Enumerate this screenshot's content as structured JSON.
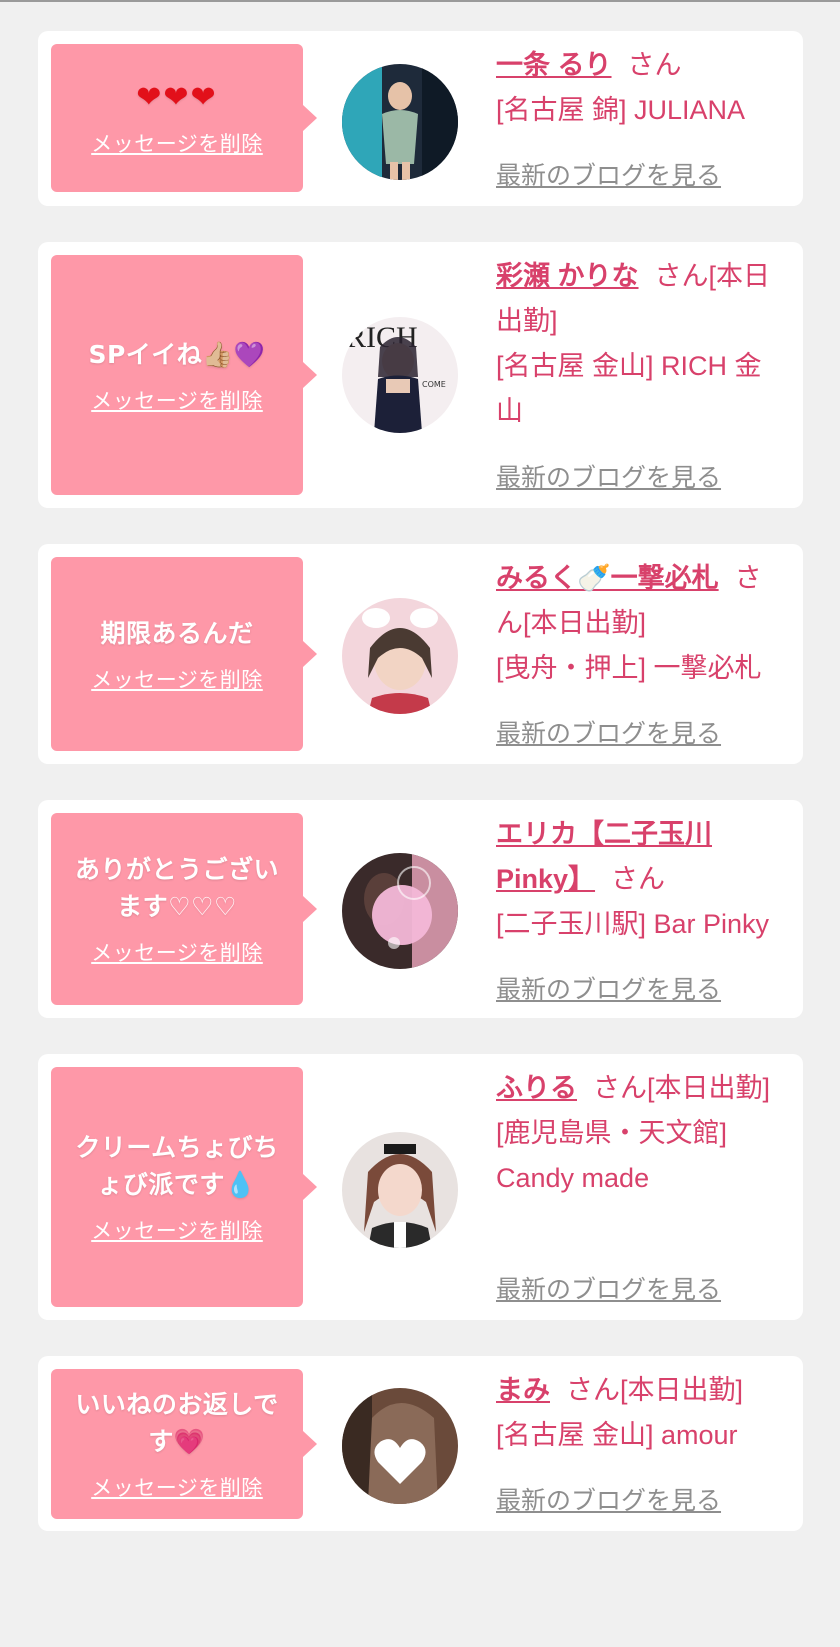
{
  "delete_label": "メッセージを削除",
  "blog_label": "最新のブログを見る",
  "honorific": "さん",
  "colors": {
    "bubble": "#fe98a8",
    "accent": "#d8416b",
    "link_gray": "#8e8e8e",
    "background": "#f0f0f0"
  },
  "cards": [
    {
      "message": "❤❤❤",
      "name": "一条 るり",
      "suffix": "さん",
      "shop": "[名古屋 錦] JULIANA"
    },
    {
      "message": "SPイイね👍🏼💜",
      "name": "彩瀬 かりな",
      "suffix": "さん[本日出勤]",
      "shop": "[名古屋 金山] RICH 金山"
    },
    {
      "message": "期限あるんだ",
      "name": "みるく🍼一撃必札",
      "suffix": "さん[本日出勤]",
      "shop": "[曳舟・押上] 一撃必札"
    },
    {
      "message": "ありがとうございます♡♡♡",
      "name": "エリカ【二子玉川Pinky】",
      "suffix": "さん",
      "shop": "[二子玉川駅] Bar Pinky"
    },
    {
      "message": "クリームちょびちょび派です💧",
      "name": "ふりる",
      "suffix": "さん[本日出勤]",
      "shop": "[鹿児島県・天文館] Candy made"
    },
    {
      "message": "いいねのお返しです💗",
      "name": "まみ",
      "suffix": "さん[本日出勤]",
      "shop": "[名古屋 金山] amour"
    }
  ]
}
